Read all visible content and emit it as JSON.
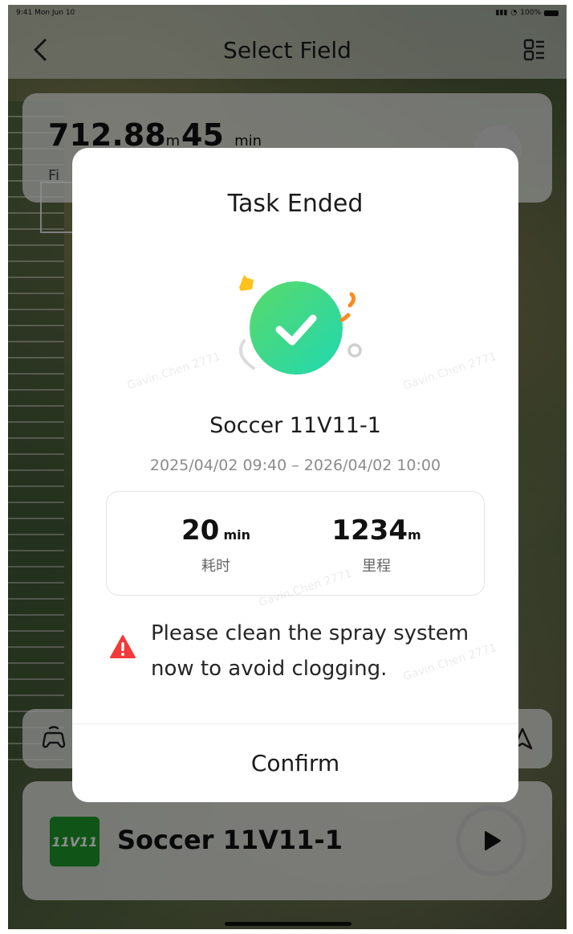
{
  "status_bar": {
    "time_date": "9:41 Mon Jun 10",
    "battery": "100%"
  },
  "nav": {
    "title": "Select Field"
  },
  "stats_card": {
    "distance_value": "712.88",
    "distance_unit": "m",
    "time_value": "45",
    "time_unit": "min",
    "sub_label": "Fi"
  },
  "modal": {
    "title": "Task Ended",
    "field_name": "Soccer 11V11-1",
    "time_range": "2025/04/02 09:40 – 2026/04/02 10:00",
    "metrics": [
      {
        "value": "20",
        "unit": "min",
        "label": "耗时"
      },
      {
        "value": "1234",
        "unit": "m",
        "label": "里程"
      }
    ],
    "warning": "Please clean the spray system now to avoid clogging.",
    "confirm_label": "Confirm"
  },
  "bottom_card": {
    "badge_text": "11V11",
    "field_name": "Soccer 11V11-1"
  },
  "watermark": "Gavin.Chen 2771",
  "colors": {
    "success_green": "#2fd39a",
    "warning_red": "#f23a3a",
    "badge_green": "#1e9b2a"
  }
}
